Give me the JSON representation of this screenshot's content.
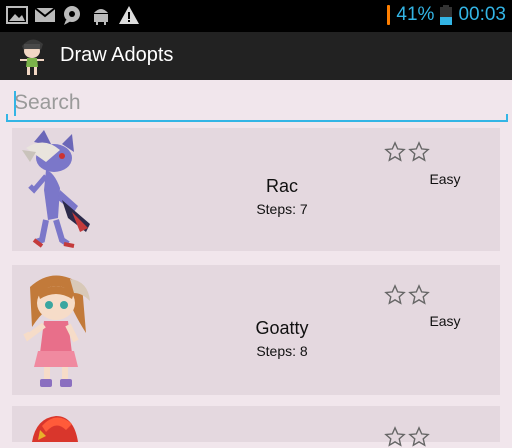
{
  "status_bar": {
    "icons": [
      "image-icon",
      "mail-icon",
      "voicemail-icon",
      "android-icon",
      "warning-icon"
    ],
    "battery_percent": "41%",
    "time": "00:03"
  },
  "app_bar": {
    "title": "Draw Adopts",
    "icon": "app-character-icon"
  },
  "search": {
    "placeholder": "Search",
    "value": ""
  },
  "adopts": [
    {
      "name": "Rac",
      "steps": "Steps: 7",
      "difficulty": "Easy",
      "stars": 2,
      "art": "purple-wolf-character"
    },
    {
      "name": "Goatty",
      "steps": "Steps: 8",
      "difficulty": "Easy",
      "stars": 2,
      "art": "goat-girl-character"
    },
    {
      "name": "",
      "steps": "",
      "difficulty": "",
      "stars": 2,
      "art": "red-hair-character"
    }
  ],
  "colors": {
    "accent": "#33b5e5",
    "action_bar": "#222222",
    "background": "#f1e6ec",
    "card": "#e4d8df"
  }
}
